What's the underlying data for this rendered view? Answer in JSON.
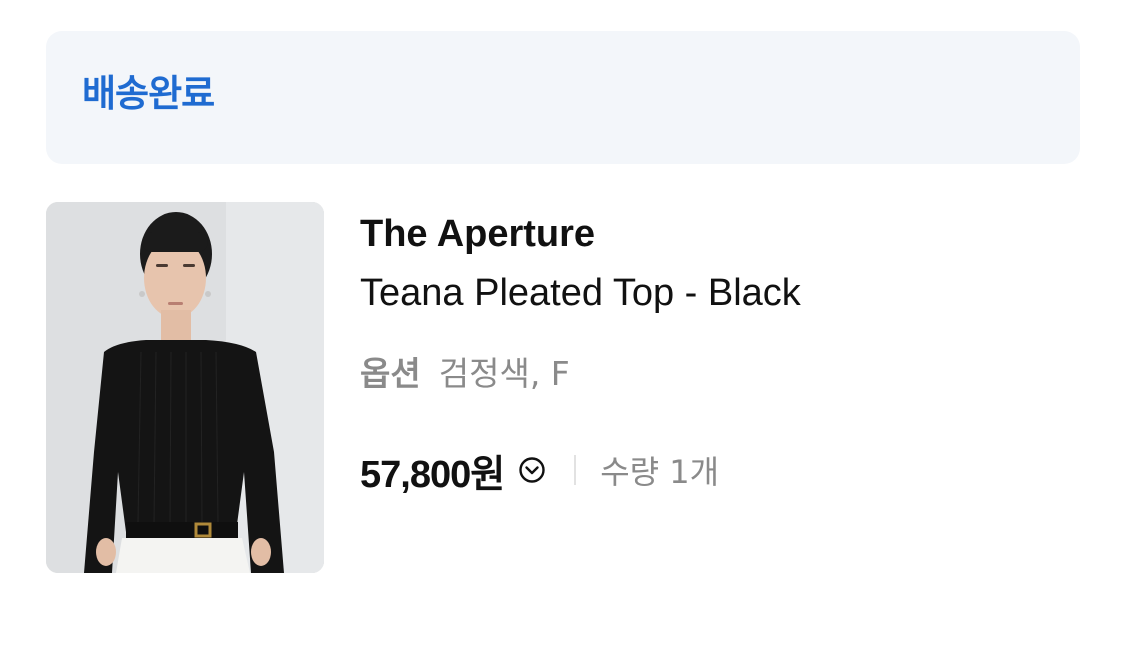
{
  "order_status": {
    "label": "배송완료",
    "color": "#1f6bd1"
  },
  "product": {
    "image_alt": "model wearing black pleated top",
    "brand": "The Aperture",
    "name": "Teana Pleated Top - Black",
    "option_label": "옵션",
    "option_value": "검정색, F",
    "price": "57,800원",
    "price_toggle_icon": "chevron-down-circle-icon",
    "quantity": "수량 1개"
  }
}
